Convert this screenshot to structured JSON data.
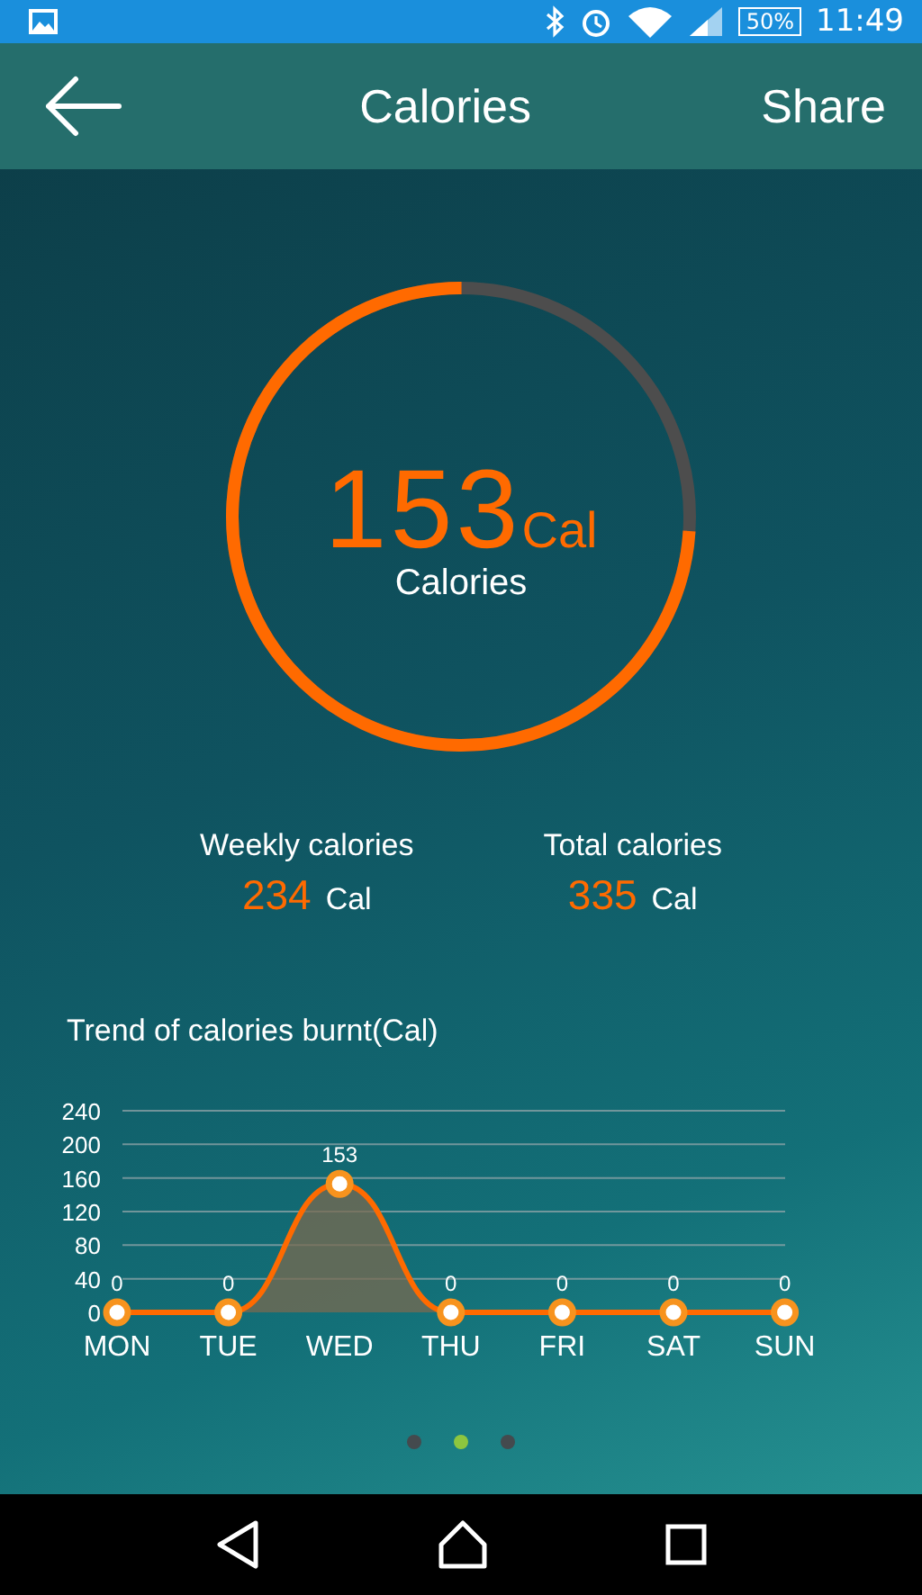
{
  "status_bar": {
    "battery": "50%",
    "time": "11:49"
  },
  "header": {
    "title": "Calories",
    "action": "Share"
  },
  "ring": {
    "value": "153",
    "unit": "Cal",
    "label": "Calories"
  },
  "stats": [
    {
      "label": "Weekly calories",
      "value": "234",
      "unit": "Cal"
    },
    {
      "label": "Total calories",
      "value": "335",
      "unit": "Cal"
    }
  ],
  "trend": {
    "title": "Trend of calories burnt(Cal)",
    "chart_data": {
      "type": "area",
      "categories": [
        "MON",
        "TUE",
        "WED",
        "THU",
        "FRI",
        "SAT",
        "SUN"
      ],
      "series": [
        {
          "color": "#ff6a00",
          "values": [
            0,
            0,
            153,
            0,
            0,
            0,
            0
          ]
        }
      ],
      "ylim": [
        0,
        240
      ],
      "yticks": [
        0,
        40,
        80,
        120,
        160,
        200,
        240
      ],
      "data_labels": true,
      "grid": true
    }
  },
  "pager": [
    {
      "selected": false
    },
    {
      "selected": true
    },
    {
      "selected": false
    }
  ]
}
